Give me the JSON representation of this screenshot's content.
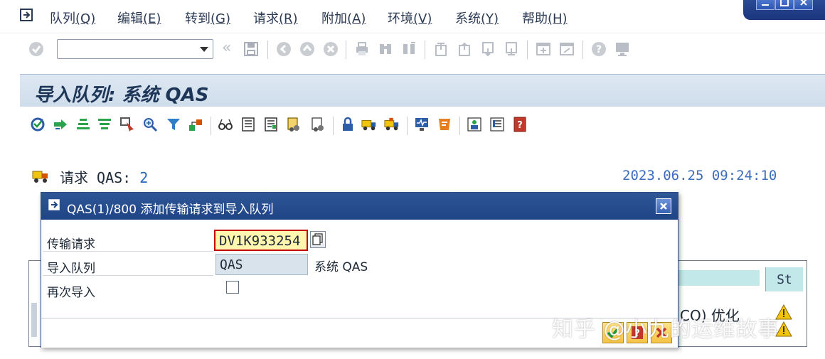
{
  "menubar": {
    "items": [
      {
        "label": "队列",
        "mnemonic": "(Q)"
      },
      {
        "label": "编辑",
        "mnemonic": "(E)"
      },
      {
        "label": "转到",
        "mnemonic": "(G)"
      },
      {
        "label": "请求",
        "mnemonic": "(R)"
      },
      {
        "label": "附加",
        "mnemonic": "(A)"
      },
      {
        "label": "环境",
        "mnemonic": "(V)"
      },
      {
        "label": "系统",
        "mnemonic": "(Y)"
      },
      {
        "label": "帮助",
        "mnemonic": "(H)"
      }
    ]
  },
  "toolbar": {
    "command_field_value": "",
    "back_glyph": "«"
  },
  "screen": {
    "title": "导入队列: 系统 QAS"
  },
  "content": {
    "requests_label": "请求 QAS:",
    "requests_count": "2",
    "timestamp": "2023.06.25 09:24:10",
    "grid_status_header": "St",
    "grid_row_fragment": "CO) 优化"
  },
  "dialog": {
    "title": "QAS(1)/800 添加传输请求到导入队列",
    "fields": {
      "transport_request": {
        "label": "传输请求",
        "value": "DV1K933254"
      },
      "import_queue": {
        "label": "导入队列",
        "value": "QAS",
        "description": "系统 QAS"
      },
      "reimport": {
        "label": "再次导入",
        "checked": false
      }
    }
  },
  "watermark": "知乎 @小九的运维故事",
  "colors": {
    "accent": "#1f4486",
    "required_border": "#c40000",
    "input_highlight": "#fff6b0",
    "title_bg": "#dde8f3"
  }
}
